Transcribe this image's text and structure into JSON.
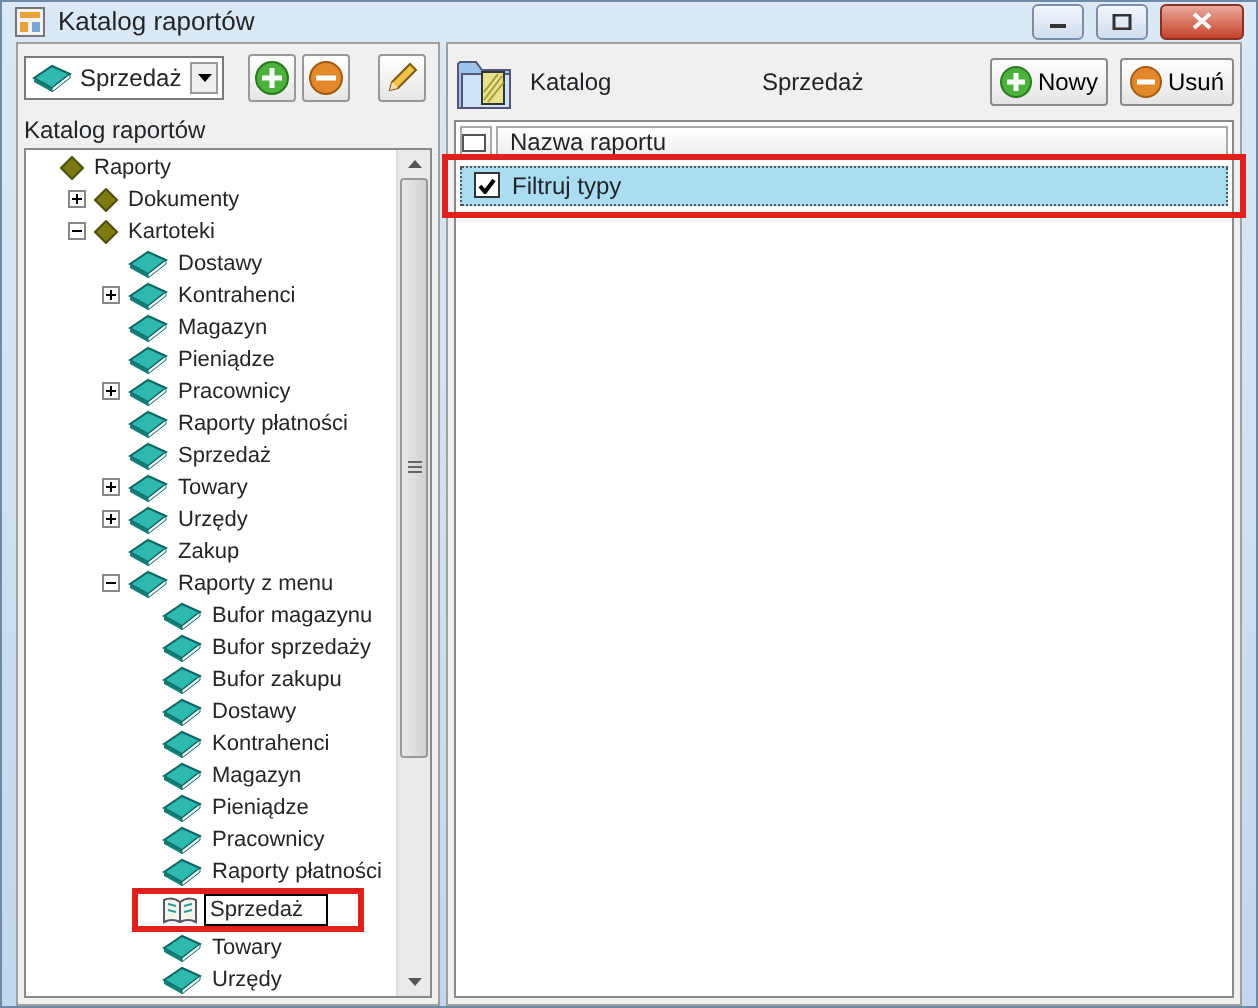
{
  "window": {
    "title": "Katalog raportów"
  },
  "left_panel": {
    "combo": {
      "value": "Sprzedaż"
    },
    "label": "Katalog raportów",
    "tree": [
      {
        "label": "Raporty",
        "children": [
          {
            "label": "Dokumenty",
            "expanded": false
          },
          {
            "label": "Kartoteki",
            "expanded": true,
            "children": [
              {
                "label": "Dostawy"
              },
              {
                "label": "Kontrahenci",
                "expanded": false
              },
              {
                "label": "Magazyn"
              },
              {
                "label": "Pieniądze"
              },
              {
                "label": "Pracownicy",
                "expanded": false
              },
              {
                "label": "Raporty płatności"
              },
              {
                "label": "Sprzedaż"
              },
              {
                "label": "Towary",
                "expanded": false
              },
              {
                "label": "Urzędy",
                "expanded": false
              },
              {
                "label": "Zakup"
              },
              {
                "label": "Raporty z menu",
                "expanded": true,
                "children": [
                  {
                    "label": "Bufor magazynu"
                  },
                  {
                    "label": "Bufor sprzedaży"
                  },
                  {
                    "label": "Bufor zakupu"
                  },
                  {
                    "label": "Dostawy"
                  },
                  {
                    "label": "Kontrahenci"
                  },
                  {
                    "label": "Magazyn"
                  },
                  {
                    "label": "Pieniądze"
                  },
                  {
                    "label": "Pracownicy"
                  },
                  {
                    "label": "Raporty płatności"
                  },
                  {
                    "label": "Sprzedaż",
                    "kind": "book-open",
                    "editing": true,
                    "highlighted": true
                  },
                  {
                    "label": "Towary"
                  },
                  {
                    "label": "Urzędy"
                  }
                ]
              }
            ]
          }
        ]
      }
    ]
  },
  "right_panel": {
    "title": "Katalog",
    "subtitle": "Sprzedaż",
    "buttons": [
      {
        "label": "Nowy",
        "kind": "add"
      },
      {
        "label": "Usuń",
        "kind": "remove"
      }
    ],
    "grid": {
      "column": "Nazwa raportu",
      "rows": [
        {
          "label": "Filtruj typy",
          "checked": true,
          "selected": true,
          "highlighted": true
        }
      ]
    }
  }
}
